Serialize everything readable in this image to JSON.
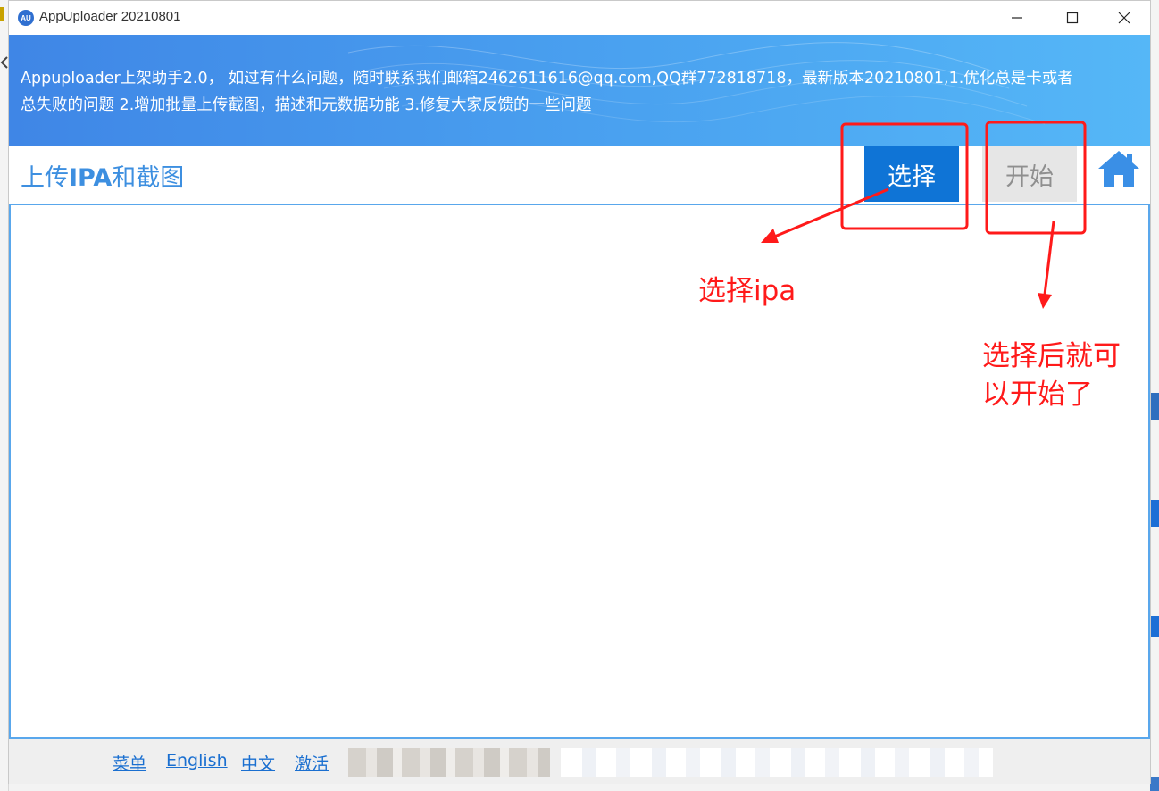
{
  "window": {
    "title": "AppUploader 20210801",
    "icon_text": "AU",
    "controls": [
      "minimize-icon",
      "maximize-icon",
      "close-icon"
    ]
  },
  "banner": {
    "line1": "Appuploader上架助手2.0， 如过有什么问题，随时联系我们邮箱2462611616@qq.com,QQ群772818718，最新版本20210801,1.优化总是卡或者",
    "line2": "总失败的问题 2.增加批量上传截图，描述和元数据功能 3.修复大家反馈的一些问题"
  },
  "toolbar": {
    "title_prefix": "上传",
    "title_bold": "IPA",
    "title_suffix": "和截图",
    "select_label": "选择",
    "start_label": "开始",
    "home_icon": "home-icon"
  },
  "footer": {
    "links": [
      "菜单",
      "English",
      "中文",
      "激活"
    ]
  },
  "annotations": {
    "label_select": "选择ipa",
    "label_start_line1": "选择后就可",
    "label_start_line2": "以开始了",
    "color": "#ff1a1a"
  },
  "colors": {
    "accent": "#0f74d6",
    "title_blue": "#3d8fe0",
    "banner_start": "#3f86e6",
    "banner_end": "#55b7f7",
    "border_blue": "#59a7ec"
  }
}
